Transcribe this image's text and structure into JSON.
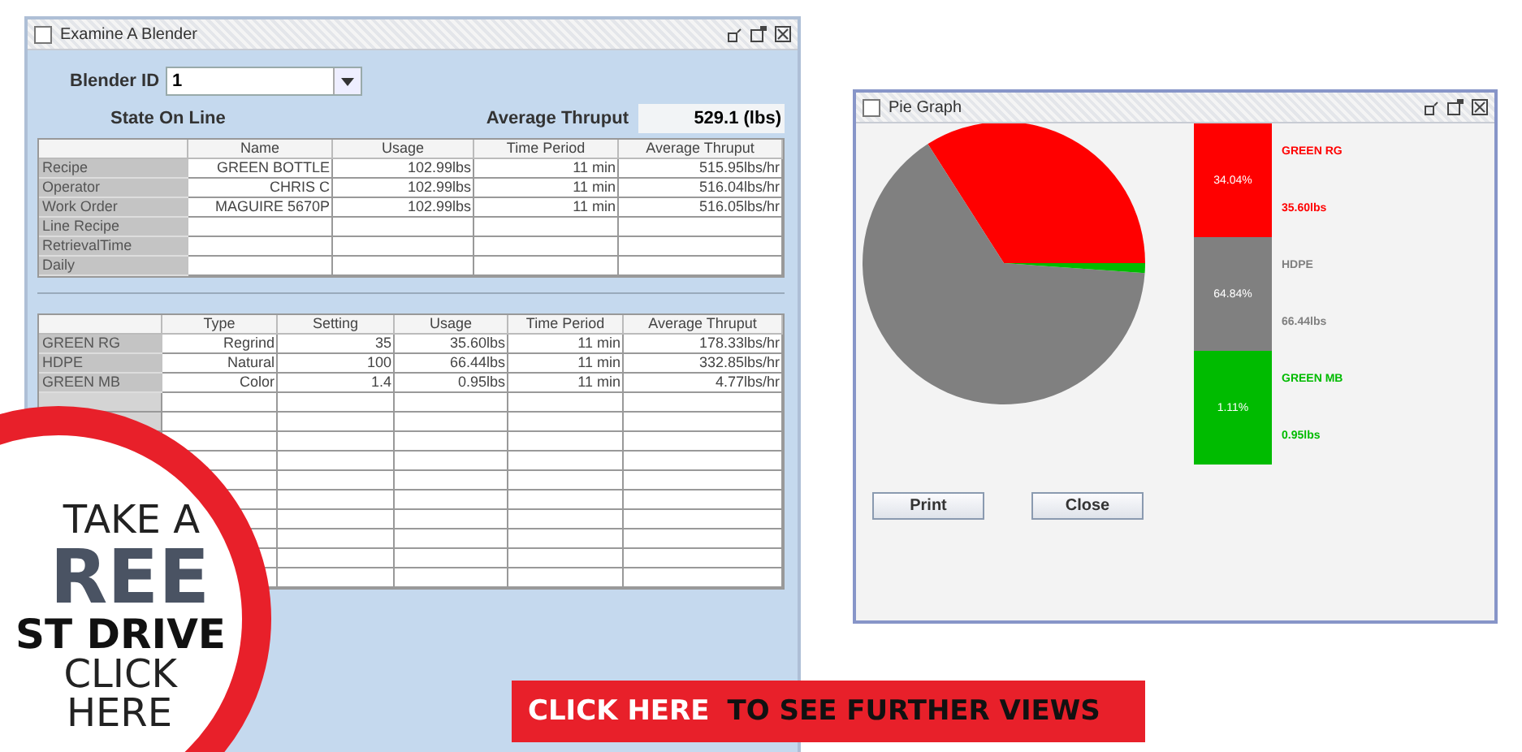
{
  "blender_window": {
    "title": "Examine A Blender",
    "blender_id": {
      "label": "Blender ID",
      "value": "1"
    },
    "state": "State On Line",
    "average_thruput": {
      "label": "Average Thruput",
      "value": "529.1 (lbs)"
    },
    "summary_table": {
      "columns": [
        "Name",
        "Usage",
        "Time Period",
        "Average Thruput"
      ],
      "rows": [
        {
          "label": "Recipe",
          "cells": [
            "GREEN BOTTLE",
            "102.99lbs",
            "11 min",
            "515.95lbs/hr"
          ]
        },
        {
          "label": "Operator",
          "cells": [
            "CHRIS C",
            "102.99lbs",
            "11 min",
            "516.04lbs/hr"
          ]
        },
        {
          "label": "Work Order",
          "cells": [
            "MAGUIRE 5670P",
            "102.99lbs",
            "11 min",
            "516.05lbs/hr"
          ]
        },
        {
          "label": "Line Recipe"
        },
        {
          "label": "RetrievalTime"
        },
        {
          "label": "Daily"
        }
      ]
    },
    "material_table": {
      "columns": [
        "Type",
        "Setting",
        "Usage",
        "Time Period",
        "Average Thruput"
      ],
      "rows": [
        {
          "label": "GREEN RG",
          "cells": [
            "Regrind",
            "35",
            "35.60lbs",
            "11 min",
            "178.33lbs/hr"
          ]
        },
        {
          "label": "HDPE",
          "cells": [
            "Natural",
            "100",
            "66.44lbs",
            "11 min",
            "332.85lbs/hr"
          ]
        },
        {
          "label": "GREEN MB",
          "cells": [
            "Color",
            "1.4",
            "0.95lbs",
            "11 min",
            "4.77lbs/hr"
          ]
        }
      ]
    }
  },
  "pie_window": {
    "title": "Pie Graph",
    "chart_data": {
      "type": "pie",
      "categories": [
        "GREEN RG",
        "HDPE",
        "GREEN MB"
      ],
      "values": [
        34.04,
        64.84,
        1.11
      ]
    },
    "legend": [
      {
        "percent": "34.04%",
        "amount": "35.60lbs",
        "color": "#ff0000"
      },
      {
        "percent": "64.84%",
        "amount": "66.44lbs",
        "color": "#808080"
      },
      {
        "percent": "1.11%",
        "amount": "0.95lbs",
        "color": "#00bb00"
      }
    ],
    "buttons": [
      "Print",
      "Close"
    ]
  },
  "promo_badge": {
    "lines": [
      "TAKE A",
      "REE",
      "ST DRIVE",
      "CLICK",
      "HERE"
    ]
  },
  "banner": {
    "action": "CLICK HERE",
    "text": "TO SEE FURTHER VIEWS"
  }
}
